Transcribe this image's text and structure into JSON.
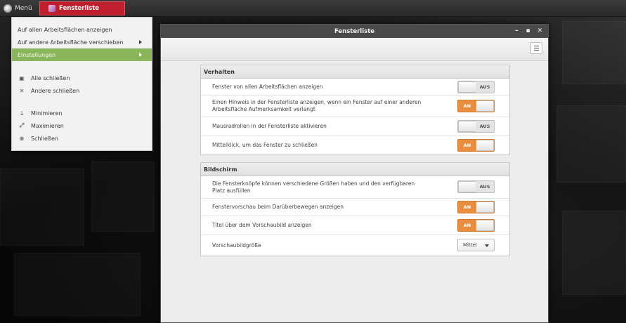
{
  "panel": {
    "menu_label": "Menü",
    "task_label": "Fensterliste"
  },
  "context_menu": {
    "items": [
      {
        "label": "Auf allen Arbeitsflächen anzeigen"
      },
      {
        "label": "Auf andere Arbeitsfläche verschieben"
      },
      {
        "label": "Einstellungen"
      },
      {
        "label": "Alle schließen"
      },
      {
        "label": "Andere schließen"
      },
      {
        "label": "Minimieren"
      },
      {
        "label": "Maximieren"
      },
      {
        "label": "Schließen"
      }
    ]
  },
  "window": {
    "title": "Fensterliste",
    "sections": [
      {
        "title": "Verhalten",
        "rows": [
          {
            "label": "Fenster von allen Arbeitsflächen anzeigen",
            "control": "toggle",
            "state": "AUS"
          },
          {
            "label": "Einen Hinweis in der Fensterliste anzeigen, wenn ein Fenster auf einer anderen Arbeitsfläche Aufmerksamkeit verlangt",
            "control": "toggle",
            "state": "AN"
          },
          {
            "label": "Mausradrollen in der Fensterliste aktivieren",
            "control": "toggle",
            "state": "AUS"
          },
          {
            "label": "Mittelklick, um das Fenster zu schließen",
            "control": "toggle",
            "state": "AN"
          }
        ]
      },
      {
        "title": "Bildschirm",
        "rows": [
          {
            "label": "Die Fensterknöpfe können verschiedene Größen haben und den verfügbaren Platz ausfüllen",
            "control": "toggle",
            "state": "AUS"
          },
          {
            "label": "Fenstervorschau beim Darüberbewegen anzeigen",
            "control": "toggle",
            "state": "AN"
          },
          {
            "label": "Titel über dem Vorschaubild anzeigen",
            "control": "toggle",
            "state": "AN"
          },
          {
            "label": "Vorschaubildgröße",
            "control": "combo",
            "value": "Mittel"
          }
        ]
      }
    ]
  },
  "colors": {
    "accent_green": "#8ab55a",
    "toggle_on": "#e88e3e",
    "panel_task": "#c0202d"
  }
}
